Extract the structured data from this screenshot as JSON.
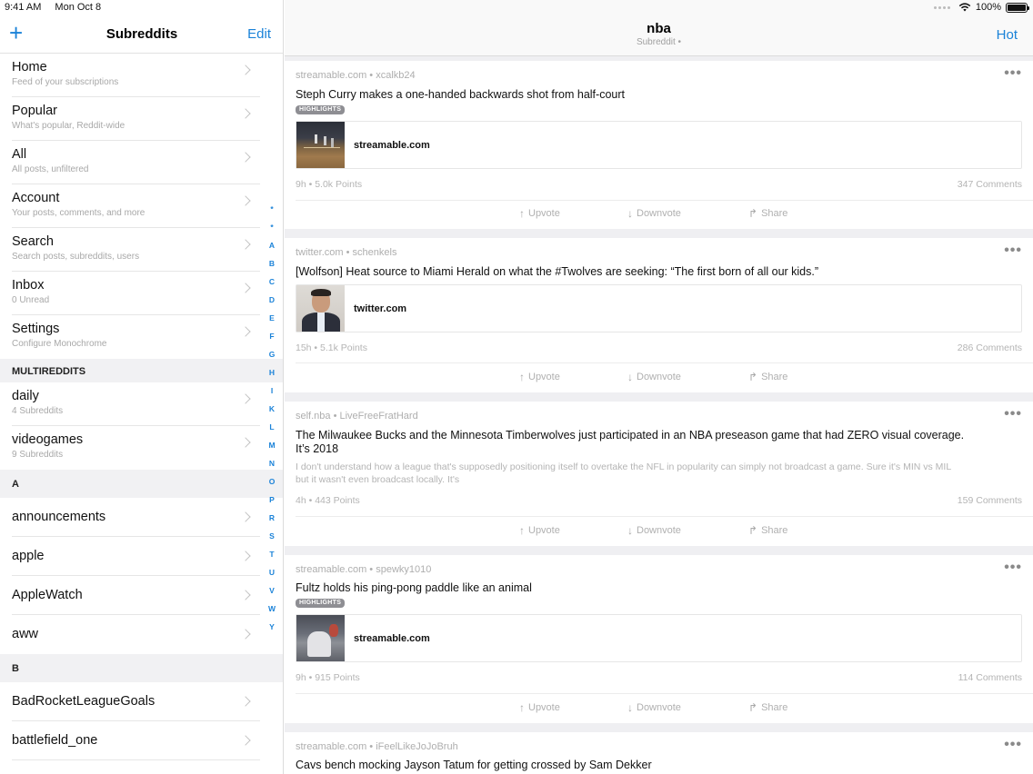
{
  "status": {
    "time": "9:41 AM",
    "date": "Mon Oct 8",
    "battery": "100%"
  },
  "sidebar": {
    "title": "Subreddits",
    "add_icon": "plus-icon",
    "edit_label": "Edit",
    "top_items": [
      {
        "label": "Home",
        "sub": "Feed of your subscriptions"
      },
      {
        "label": "Popular",
        "sub": "What's popular, Reddit-wide"
      },
      {
        "label": "All",
        "sub": "All posts, unfiltered"
      },
      {
        "label": "Account",
        "sub": "Your posts, comments, and more"
      },
      {
        "label": "Search",
        "sub": "Search posts, subreddits, users"
      },
      {
        "label": "Inbox",
        "sub": "0 Unread"
      },
      {
        "label": "Settings",
        "sub": "Configure Monochrome"
      }
    ],
    "multireddits_header": "MULTIREDDITS",
    "multireddits": [
      {
        "label": "daily",
        "sub": "4 Subreddits"
      },
      {
        "label": "videogames",
        "sub": "9 Subreddits"
      }
    ],
    "section_a": "A",
    "a_items": [
      "announcements",
      "apple",
      "AppleWatch",
      "aww"
    ],
    "section_b": "B",
    "b_items": [
      "BadRocketLeagueGoals",
      "battlefield_one"
    ],
    "index_letters": [
      "*",
      "*",
      "A",
      "B",
      "C",
      "D",
      "E",
      "F",
      "G",
      "H",
      "I",
      "K",
      "L",
      "M",
      "N",
      "O",
      "P",
      "R",
      "S",
      "T",
      "U",
      "V",
      "W",
      "Y"
    ]
  },
  "main": {
    "title": "nba",
    "subtitle": "Subreddit •",
    "sort_label": "Hot",
    "actions": {
      "upvote": "Upvote",
      "downvote": "Downvote",
      "share": "Share"
    },
    "posts": [
      {
        "meta": "streamable.com • xcalkb24",
        "title": "Steph Curry makes a one-handed backwards shot from half-court",
        "flair": "HIGHLIGHTS",
        "link_domain": "streamable.com",
        "stats": "9h • 5.0k Points",
        "comments": "347 Comments"
      },
      {
        "meta": "twitter.com • schenkels",
        "title": "[Wolfson] Heat source to Miami Herald on what the #Twolves are seeking: “The first born of all our kids.”",
        "link_domain": "twitter.com",
        "stats": "15h • 5.1k Points",
        "comments": "286 Comments"
      },
      {
        "meta": "self.nba • LiveFreeFratHard",
        "title_line1": "The Milwaukee Bucks and the Minnesota Timberwolves just participated in an NBA preseason game that had ZERO visual coverage.",
        "title_line2": "It’s 2018",
        "selftext_line1": "I don't understand how a league that's supposedly positioning itself to overtake the NFL in popularity can simply not broadcast a game. Sure it's MIN vs MIL",
        "selftext_line2": "but it wasn't even broadcast locally. It's",
        "stats": "4h • 443 Points",
        "comments": "159 Comments"
      },
      {
        "meta": "streamable.com • spewky1010",
        "title": "Fultz holds his ping-pong paddle like an animal",
        "flair": "HIGHLIGHTS",
        "link_domain": "streamable.com",
        "stats": "9h • 915 Points",
        "comments": "114 Comments"
      },
      {
        "meta": "streamable.com • iFeelLikeJoJoBruh",
        "title": "Cavs bench mocking Jayson Tatum for getting crossed by Sam Dekker"
      }
    ]
  }
}
